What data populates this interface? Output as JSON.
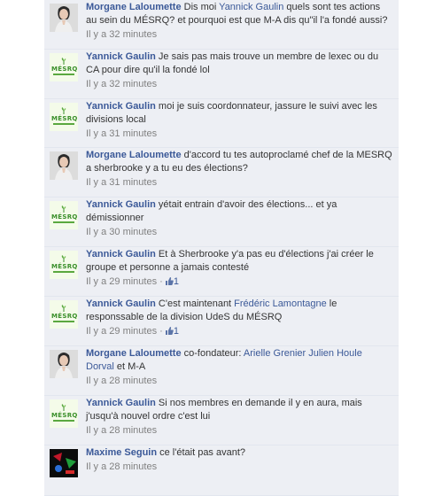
{
  "comments": [
    {
      "author": "Morgane Laloumette",
      "avatar": "photo",
      "parts": [
        {
          "type": "text",
          "value": " Dis moi "
        },
        {
          "type": "mention",
          "value": "Yannick Gaulin"
        },
        {
          "type": "text",
          "value": " quels sont tes actions au sein du MÉSRQ? et pourquoi est que M-A dis qu\"il l'a fondé aussi?"
        }
      ],
      "time": "Il y a 32 minutes",
      "likes": ""
    },
    {
      "author": "Yannick Gaulin",
      "avatar": "logo",
      "parts": [
        {
          "type": "text",
          "value": " Je sais pas mais trouve un membre de lexec ou du CA pour dire qu'il la fondé lol"
        }
      ],
      "time": "Il y a 32 minutes",
      "likes": ""
    },
    {
      "author": "Yannick Gaulin",
      "avatar": "logo",
      "parts": [
        {
          "type": "text",
          "value": " moi je suis coordonnateur, jassure le suivi avec les divisions local"
        }
      ],
      "time": "Il y a 31 minutes",
      "likes": ""
    },
    {
      "author": "Morgane Laloumette",
      "avatar": "photo",
      "parts": [
        {
          "type": "text",
          "value": " d'accord tu tes autoproclamé chef de la MESRQ a sherbrooke y a tu eu des élections?"
        }
      ],
      "time": "Il y a 31 minutes",
      "likes": ""
    },
    {
      "author": "Yannick Gaulin",
      "avatar": "logo",
      "parts": [
        {
          "type": "text",
          "value": " yétait entrain d'avoir des élections... et ya démissionner"
        }
      ],
      "time": "Il y a 30 minutes",
      "likes": ""
    },
    {
      "author": "Yannick Gaulin",
      "avatar": "logo",
      "parts": [
        {
          "type": "text",
          "value": " Et à Sherbrooke y'a pas eu d'élections j'ai créer le groupe et personne a jamais contesté"
        }
      ],
      "time": "Il y a 29 minutes",
      "likes": "1"
    },
    {
      "author": "Yannick Gaulin",
      "avatar": "logo",
      "parts": [
        {
          "type": "text",
          "value": " C'est maintenant "
        },
        {
          "type": "mention",
          "value": "Frédéric Lamontagne"
        },
        {
          "type": "text",
          "value": " le responssable de la division UdeS du MÉSRQ"
        }
      ],
      "time": "Il y a 29 minutes",
      "likes": "1"
    },
    {
      "author": "Morgane Laloumette",
      "avatar": "photo",
      "parts": [
        {
          "type": "text",
          "value": " co-fondateur: "
        },
        {
          "type": "mention",
          "value": "Arielle Grenier"
        },
        {
          "type": "text",
          "value": " "
        },
        {
          "type": "mention",
          "value": "Julien Houle Dorval"
        },
        {
          "type": "text",
          "value": " et M-A"
        }
      ],
      "time": "Il y a 28 minutes",
      "likes": ""
    },
    {
      "author": "Yannick Gaulin",
      "avatar": "logo",
      "parts": [
        {
          "type": "text",
          "value": " Si nos membres en demande il y en aura, mais j'usqu'à nouvel ordre c'est lui"
        }
      ],
      "time": "Il y a 28 minutes",
      "likes": ""
    },
    {
      "author": "Maxime Seguin",
      "avatar": "dark",
      "parts": [
        {
          "type": "text",
          "value": " ce l'était pas avant?"
        }
      ],
      "time": "Il y a 28 minutes",
      "likes": ""
    }
  ],
  "logo_text": "MÉSRQ",
  "colors": {
    "link": "#3b5998",
    "meta": "#808080",
    "background": "#edeff4",
    "logo_green": "#3a8f2a"
  },
  "icons": {
    "like": "thumbs-up-icon"
  }
}
